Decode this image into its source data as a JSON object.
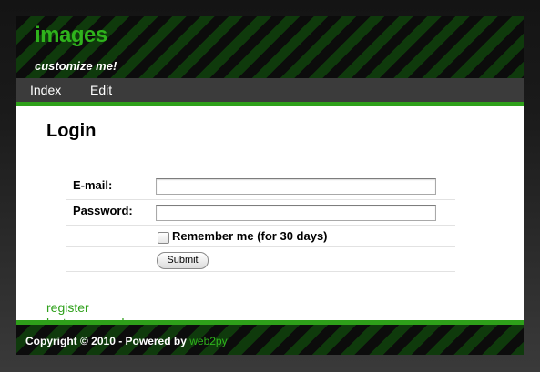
{
  "header": {
    "title": "images",
    "subtitle": "customize me!"
  },
  "menu": {
    "items": [
      {
        "label": "Index"
      },
      {
        "label": "Edit"
      }
    ]
  },
  "login": {
    "title": "Login",
    "email_label": "E-mail:",
    "email_value": "",
    "password_label": "Password:",
    "password_value": "",
    "remember_label": "Remember me (for 30 days)",
    "remember_checked": false,
    "submit_label": "Submit"
  },
  "links": {
    "register": "register",
    "lost_password": "lost password"
  },
  "footer": {
    "copyright": "Copyright © 2010 - Powered by",
    "powered_by": "web2py"
  },
  "colors": {
    "accent": "#2ea01a",
    "header_stripe": "#0f3a0c",
    "menu_bg": "#3b3b3b"
  }
}
